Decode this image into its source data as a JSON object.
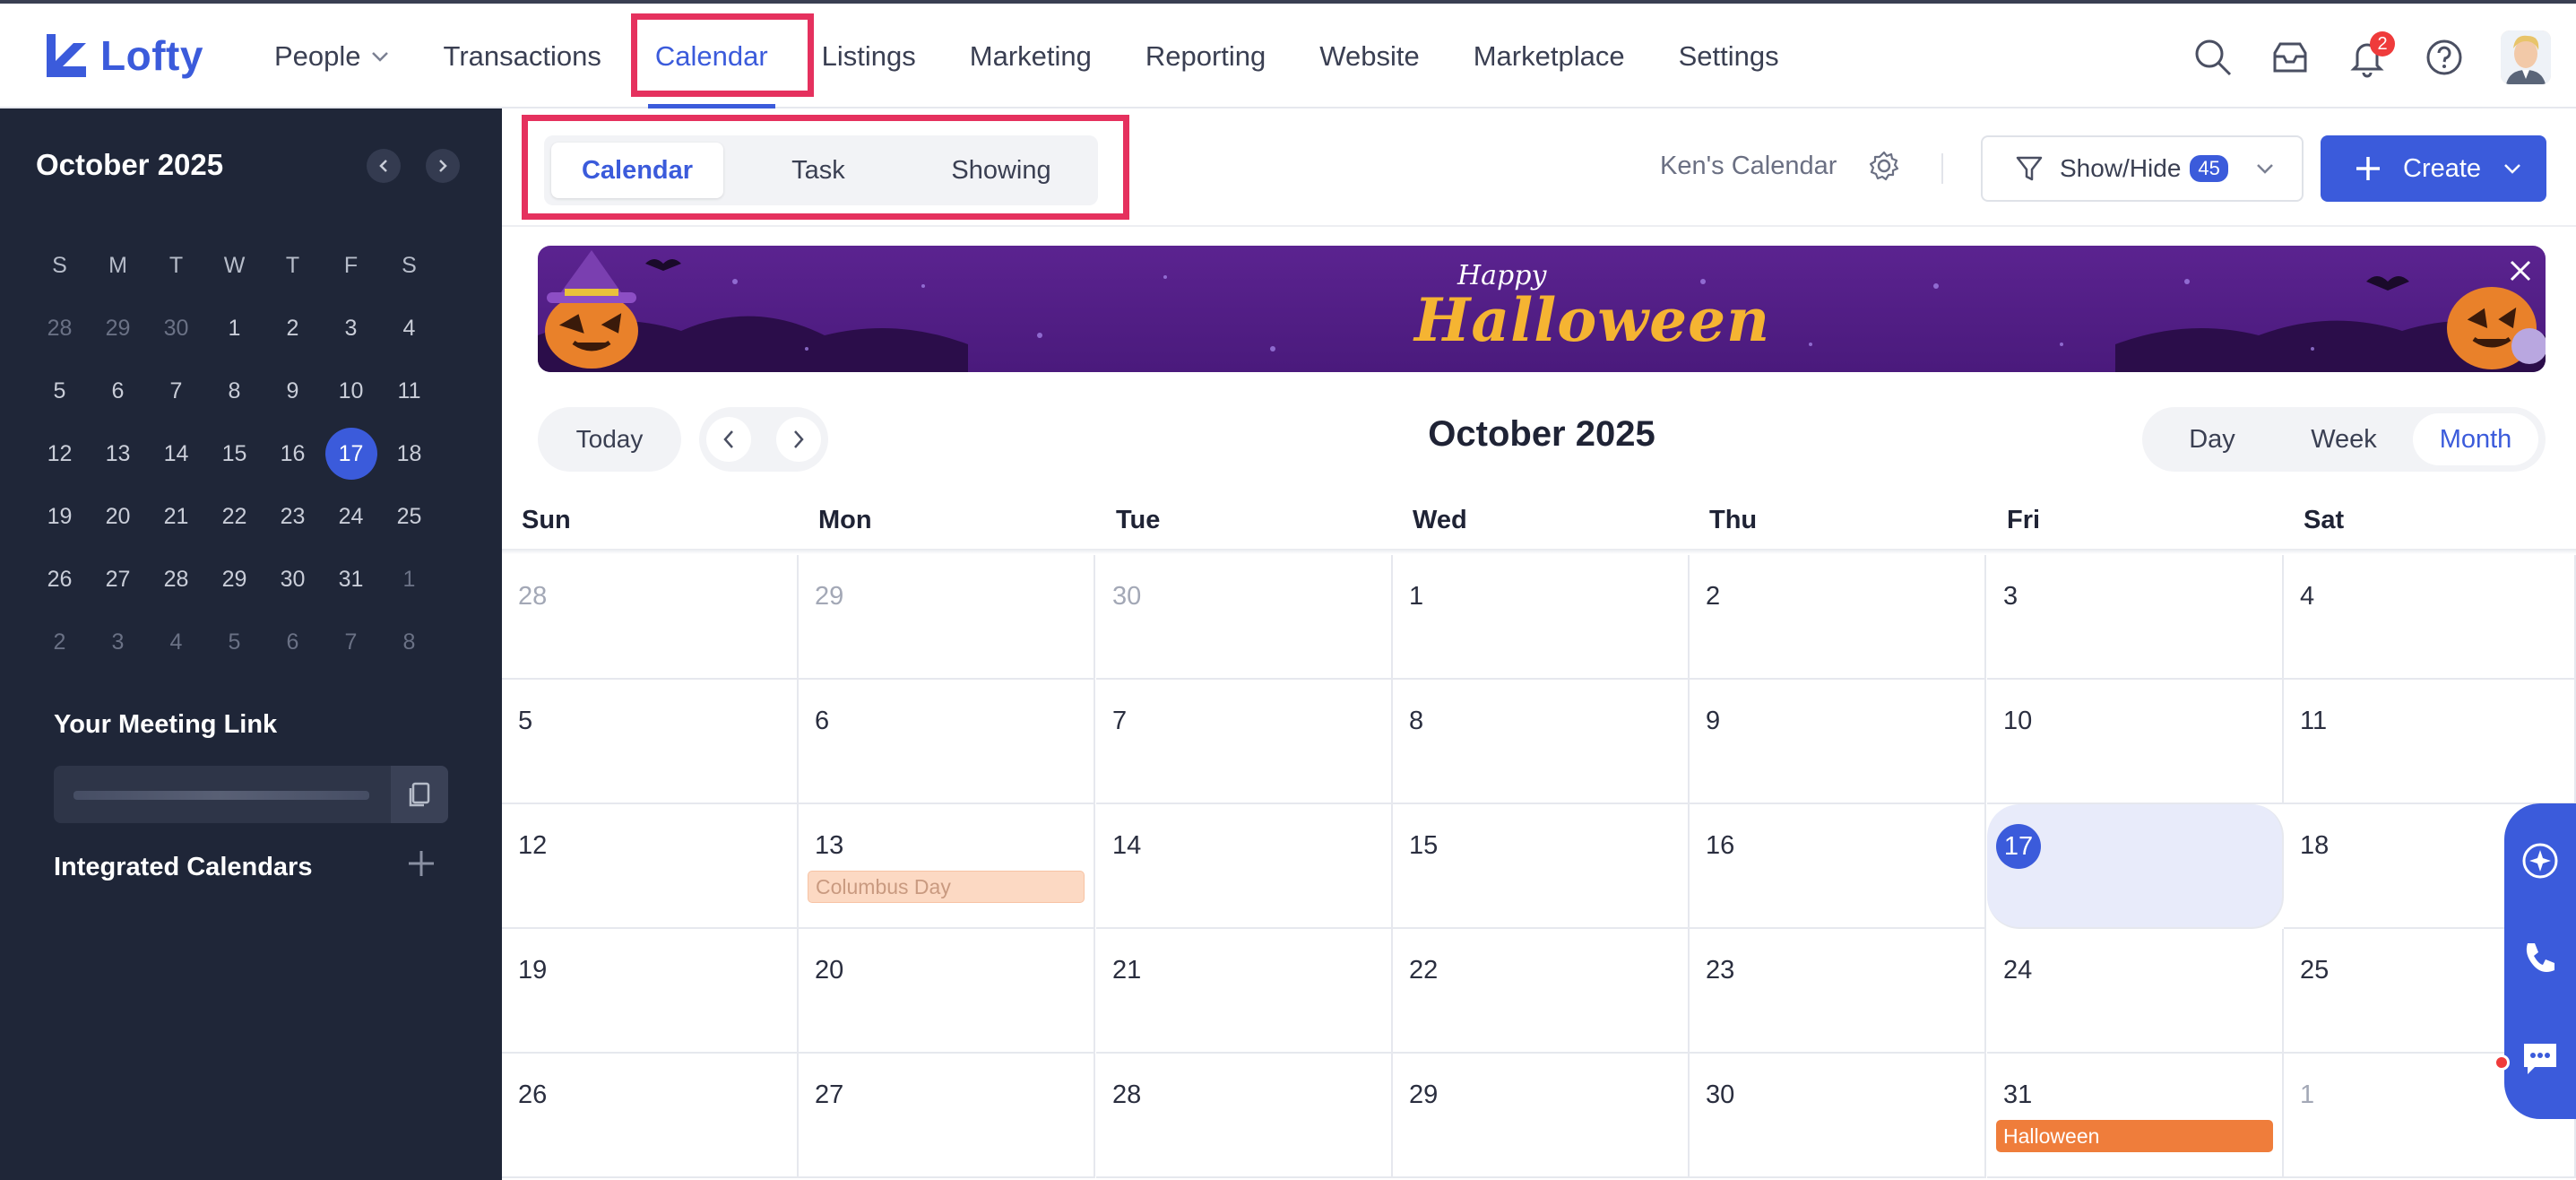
{
  "app": {
    "name": "Lofty"
  },
  "nav": {
    "items": [
      {
        "label": "People",
        "has_dropdown": true
      },
      {
        "label": "Transactions"
      },
      {
        "label": "Calendar",
        "active": true
      },
      {
        "label": "Listings"
      },
      {
        "label": "Marketing"
      },
      {
        "label": "Reporting"
      },
      {
        "label": "Website"
      },
      {
        "label": "Marketplace"
      },
      {
        "label": "Settings"
      }
    ],
    "notification_count": "2",
    "icons": [
      "search-icon",
      "inbox-icon",
      "bell-icon",
      "help-icon",
      "avatar"
    ]
  },
  "sidebar": {
    "month_title": "October 2025",
    "weekdays": [
      "S",
      "M",
      "T",
      "W",
      "T",
      "F",
      "S"
    ],
    "weeks": [
      [
        "28",
        "29",
        "30",
        "1",
        "2",
        "3",
        "4"
      ],
      [
        "5",
        "6",
        "7",
        "8",
        "9",
        "10",
        "11"
      ],
      [
        "12",
        "13",
        "14",
        "15",
        "16",
        "17",
        "18"
      ],
      [
        "19",
        "20",
        "21",
        "22",
        "23",
        "24",
        "25"
      ],
      [
        "26",
        "27",
        "28",
        "29",
        "30",
        "31",
        "1"
      ],
      [
        "2",
        "3",
        "4",
        "5",
        "6",
        "7",
        "8"
      ]
    ],
    "selected_day": "17",
    "meeting_link_label": "Your Meeting Link",
    "integrated_calendars_label": "Integrated Calendars"
  },
  "header": {
    "tabs": [
      {
        "label": "Calendar",
        "active": true
      },
      {
        "label": "Task"
      },
      {
        "label": "Showing"
      }
    ],
    "calendar_owner": "Ken's Calendar",
    "show_hide_label": "Show/Hide",
    "show_hide_count": "45",
    "create_label": "Create"
  },
  "banner": {
    "line1": "Happy",
    "line2": "Halloween"
  },
  "toolbar": {
    "today_label": "Today",
    "title": "October 2025",
    "views": [
      {
        "label": "Day"
      },
      {
        "label": "Week"
      },
      {
        "label": "Month",
        "active": true
      }
    ]
  },
  "calendar": {
    "day_headers": [
      "Sun",
      "Mon",
      "Tue",
      "Wed",
      "Thu",
      "Fri",
      "Sat"
    ],
    "weeks": [
      [
        "28",
        "29",
        "30",
        "1",
        "2",
        "3",
        "4"
      ],
      [
        "5",
        "6",
        "7",
        "8",
        "9",
        "10",
        "11"
      ],
      [
        "12",
        "13",
        "14",
        "15",
        "16",
        "17",
        "18"
      ],
      [
        "19",
        "20",
        "21",
        "22",
        "23",
        "24",
        "25"
      ],
      [
        "26",
        "27",
        "28",
        "29",
        "30",
        "31",
        "1"
      ]
    ],
    "today": "17",
    "events": [
      {
        "week": 2,
        "day": 1,
        "label": "Columbus Day",
        "kind": "columbus"
      },
      {
        "week": 4,
        "day": 5,
        "label": "Halloween",
        "kind": "halloween"
      }
    ]
  },
  "colors": {
    "accent": "#3b5bdb",
    "sidebar_bg": "#1f2638",
    "highlight": "#e5315e",
    "halloween_event": "#ef7d3b"
  }
}
